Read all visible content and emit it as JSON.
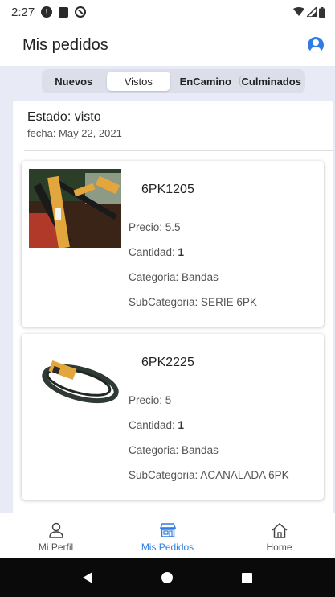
{
  "status_bar": {
    "time": "2:27"
  },
  "header": {
    "title": "Mis pedidos"
  },
  "segments": [
    "Nuevos",
    "Vistos",
    "EnCamino",
    "Culminados"
  ],
  "order": {
    "status": "Estado: visto",
    "date": "fecha: May 22, 2021"
  },
  "products": [
    {
      "name": "6PK1205",
      "price": "Precio: 5.5",
      "qty_label": "Cantidad: ",
      "qty_value": "1",
      "category": "Categoria: Bandas",
      "subcategory": "SubCategoria: SERIE 6PK"
    },
    {
      "name": "6PK2225",
      "price": "Precio: 5",
      "qty_label": "Cantidad: ",
      "qty_value": "1",
      "category": "Categoria: Bandas",
      "subcategory": "SubCategoria: ACANALADA 6PK"
    }
  ],
  "bottom_nav": {
    "profile": "Mi Perfil",
    "orders": "Mis Pedidos",
    "home": "Home"
  },
  "colors": {
    "accent": "#2f7de1",
    "panel": "#e8eaf6"
  }
}
